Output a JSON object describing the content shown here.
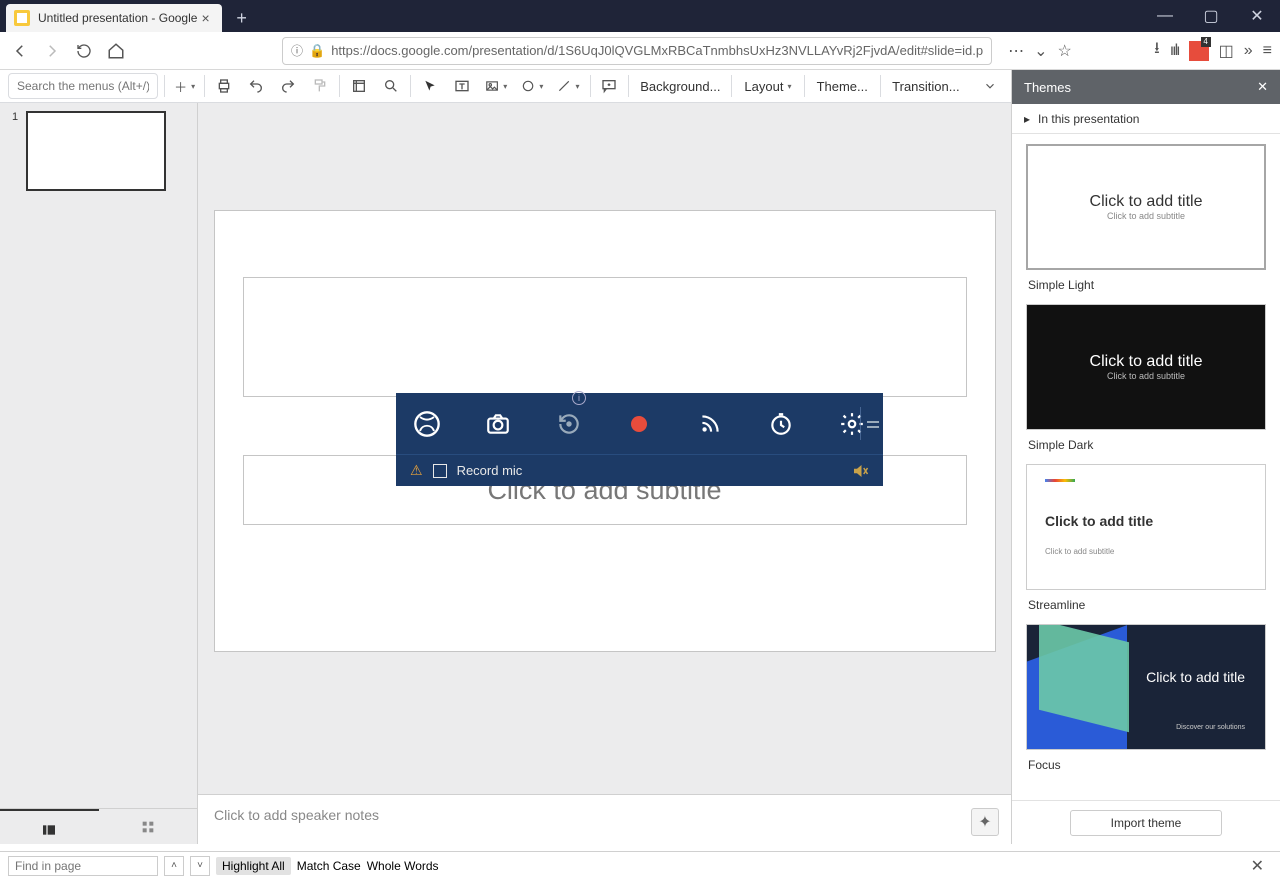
{
  "browser": {
    "tab_title": "Untitled presentation - Google",
    "url": "https://docs.google.com/presentation/d/1S6UqJ0lQVGLMxRBCaTnmbhsUxHz3NVLLAYvRj2FjvdA/edit#slide=id.p",
    "badge_count": "4"
  },
  "toolbar": {
    "search_placeholder": "Search the menus (Alt+/)",
    "background": "Background...",
    "layout": "Layout",
    "theme": "Theme...",
    "transition": "Transition..."
  },
  "filmstrip": {
    "slide_number": "1"
  },
  "slide": {
    "subtitle_placeholder": "Click to add subtitle"
  },
  "notes": {
    "placeholder": "Click to add speaker notes"
  },
  "themes": {
    "header": "Themes",
    "subhead": "In this presentation",
    "import": "Import theme",
    "items": [
      {
        "name": "Simple Light",
        "title": "Click to add title",
        "sub": "Click to add subtitle"
      },
      {
        "name": "Simple Dark",
        "title": "Click to add title",
        "sub": "Click to add subtitle"
      },
      {
        "name": "Streamline",
        "title": "Click to add title",
        "sub": "Click to add subtitle"
      },
      {
        "name": "Focus",
        "title": "Click to add title",
        "sub": "Discover our solutions"
      }
    ]
  },
  "gamebar": {
    "record_mic": "Record mic"
  },
  "findbar": {
    "placeholder": "Find in page",
    "highlight": "Highlight All",
    "match": "Match Case",
    "whole": "Whole Words"
  }
}
